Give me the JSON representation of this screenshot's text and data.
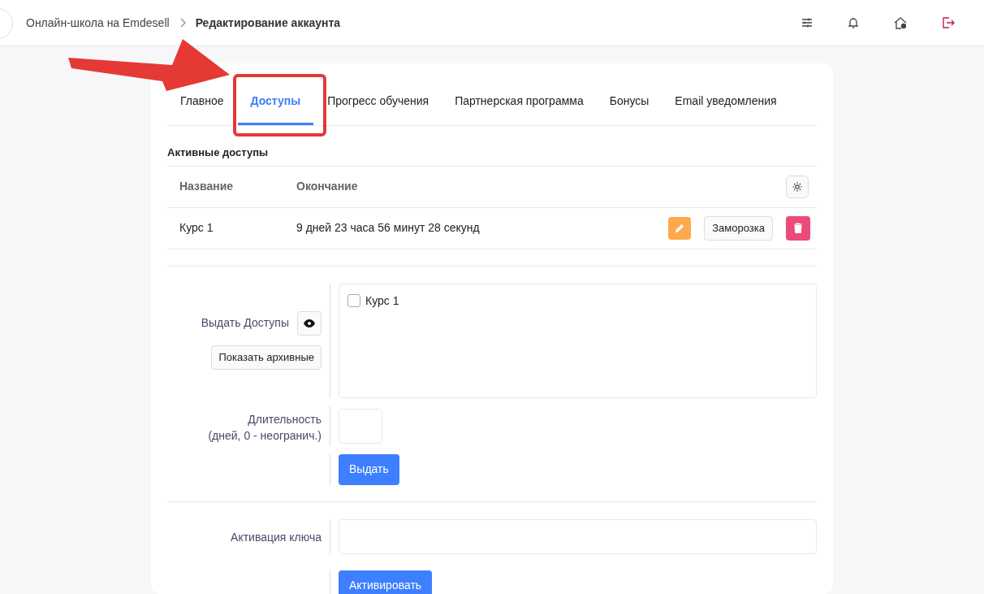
{
  "breadcrumb": [
    "Онлайн-школа на Emdesell",
    "Редактирование аккаунта"
  ],
  "tabs": [
    {
      "label": "Главное",
      "selected": false
    },
    {
      "label": "Доступы",
      "selected": true
    },
    {
      "label": "Прогресс обучения",
      "selected": false
    },
    {
      "label": "Партнерская программа",
      "selected": false
    },
    {
      "label": "Бонусы",
      "selected": false
    },
    {
      "label": "Email уведомления",
      "selected": false
    }
  ],
  "active_access": {
    "title": "Активные доступы",
    "columns": [
      "Название",
      "Окончание"
    ],
    "rows": [
      {
        "name": "Курс 1",
        "ending": "9 дней 23 часа 56 минут 28 секунд",
        "freeze_button": "Заморозка"
      }
    ]
  },
  "grant": {
    "label": "Выдать Доступы",
    "archive_button": "Показать архивные",
    "courses": [
      {
        "label": "Курс 1",
        "checked": false
      }
    ],
    "duration_label": "Длительность\n(дней, 0 - неогранич.)",
    "submit": "Выдать"
  },
  "key": {
    "label": "Активация ключа",
    "submit": "Активировать"
  }
}
